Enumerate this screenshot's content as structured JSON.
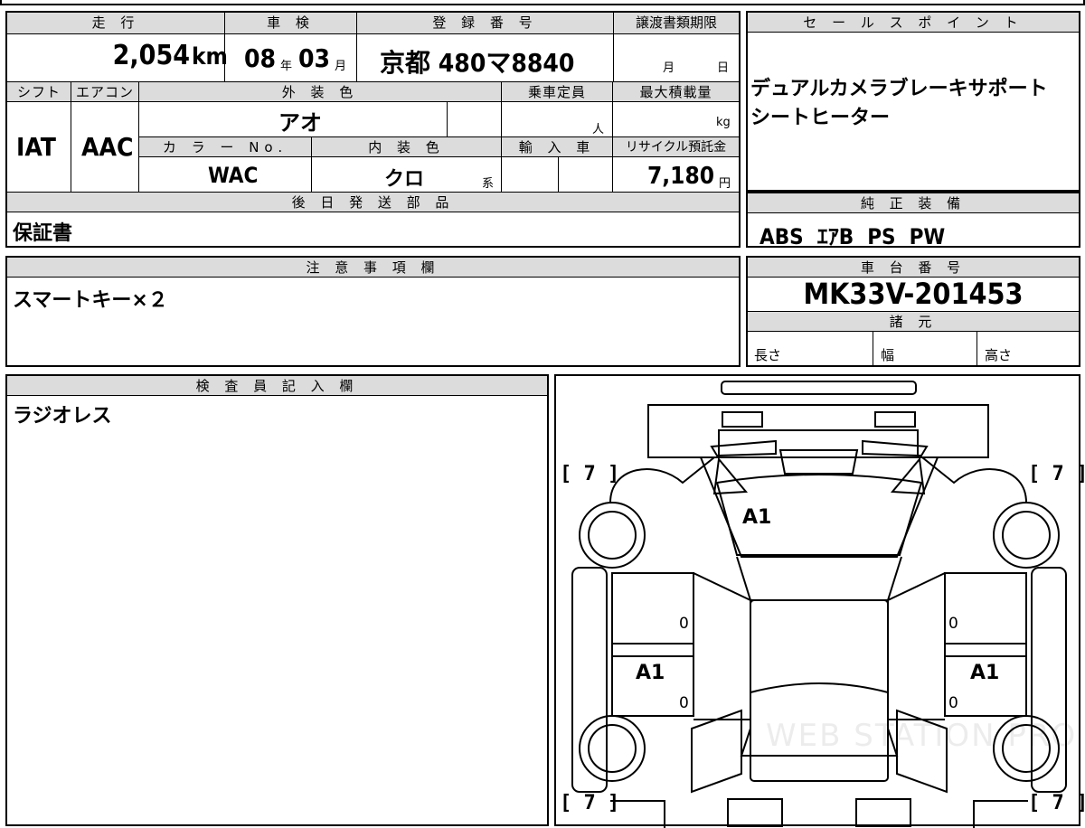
{
  "vehicle": {
    "mileage_label": "走 行",
    "mileage_value": "2,054",
    "mileage_unit": "km",
    "inspection_label": "車 検",
    "inspection_year": "08",
    "inspection_year_unit": "年",
    "inspection_month": "03",
    "inspection_month_unit": "月",
    "registration_label": "登 録 番 号",
    "registration_value": "京都 480マ8840",
    "transfer_label": "譲渡書類期限",
    "transfer_month_unit": "月",
    "transfer_day_unit": "日",
    "shift_label": "シフト",
    "shift_value": "IAT",
    "aircon_label": "エアコン",
    "aircon_value": "AAC",
    "exterior_label": "外 装 色",
    "exterior_value": "アオ",
    "color_no_label": "カ ラ ー No.",
    "color_no_value": "WAC",
    "interior_label": "内 装 色",
    "interior_value": "クロ",
    "interior_suffix": "系",
    "capacity_label": "乗車定員",
    "capacity_unit": "人",
    "load_label": "最大積載量",
    "load_unit": "kg",
    "import_label": "輸 入 車",
    "recycle_label": "リサイクル預託金",
    "recycle_value": "7,180",
    "recycle_unit": "円"
  },
  "sales_point": {
    "label": "セ ー ル ス ポ イ ン ト",
    "lines": [
      "デュアルカメラブレーキサポート",
      "シートヒーター"
    ]
  },
  "later_parts": {
    "label": "後 日 発 送 部 品",
    "value": "保証書"
  },
  "genuine_equipment": {
    "label": "純 正 装 備",
    "value": "ABS  ｴｱB  PS  PW"
  },
  "notes": {
    "label": "注 意 事 項 欄",
    "value": "スマートキー×２"
  },
  "chassis": {
    "label": "車 台 番 号",
    "value": "MK33V-201453"
  },
  "specs": {
    "label": "諸 元",
    "length_label": "長さ",
    "width_label": "幅",
    "height_label": "高さ"
  },
  "inspector": {
    "label": "検 査 員 記 入 欄",
    "value": "ラジオレス"
  },
  "diagram": {
    "tire_front_left": "7",
    "tire_front_right": "7",
    "tire_rear_left": "7",
    "tire_rear_right": "7",
    "windshield_damage": "A1",
    "left_door_damage": "A1",
    "right_door_damage": "A1",
    "left_front_door_value": "0",
    "left_rear_door_value": "0",
    "right_front_door_value": "0",
    "right_rear_door_value": "0",
    "watermark": "WEB STATION PRO"
  }
}
